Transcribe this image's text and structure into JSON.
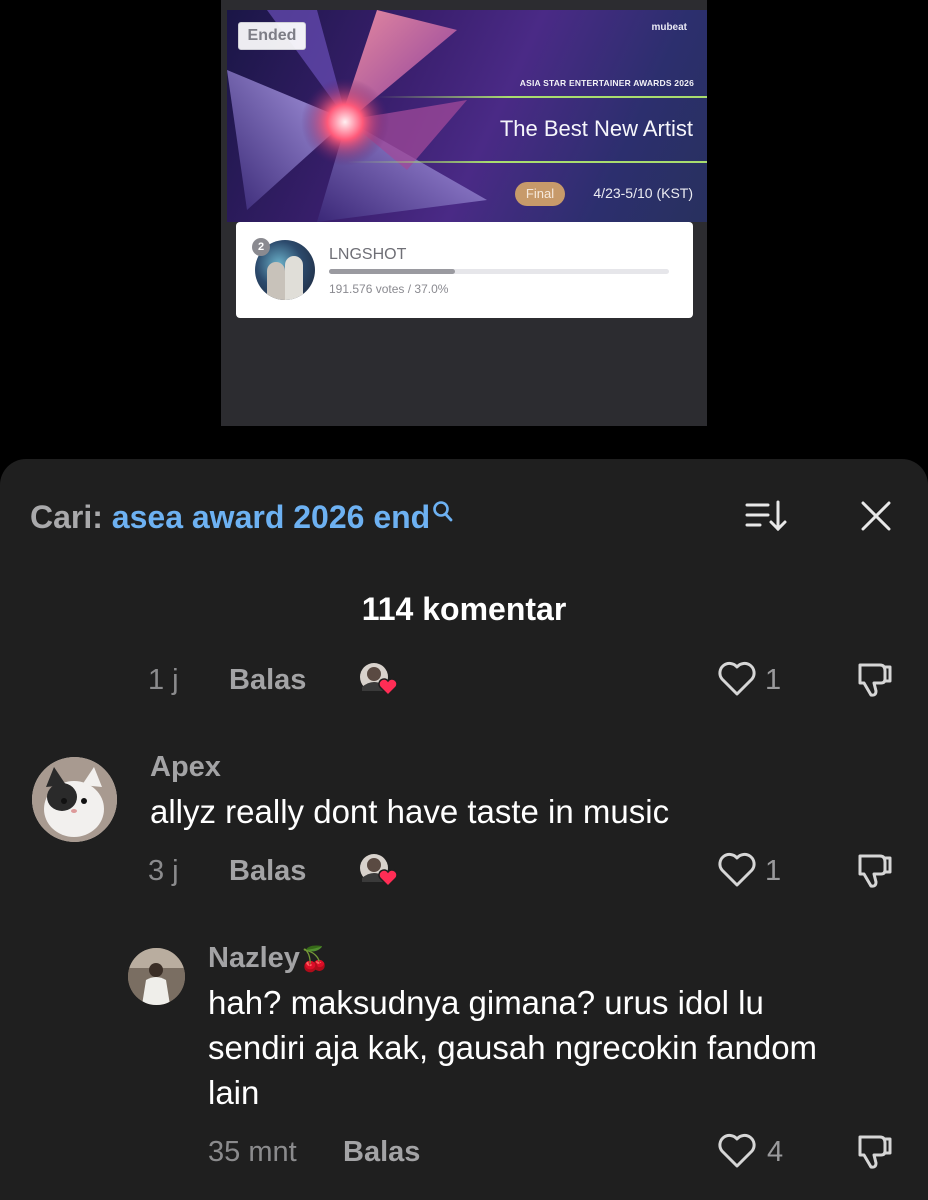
{
  "card": {
    "status_badge": "Ended",
    "brand": "mubeat",
    "award_name": "ASIA STAR ENTERTAINER AWARDS 2026",
    "category": "The Best New Artist",
    "round": "Final",
    "dates": "4/23-5/10 (KST)",
    "entry": {
      "rank": "2",
      "artist": "LNGSHOT",
      "votes_text": "191.576 votes / 37.0%",
      "progress_percent": 37.0
    }
  },
  "sheet": {
    "search_label": "Cari:",
    "search_query": "asea award 2026 end",
    "comment_count": "114 komentar",
    "icons": {
      "search": "search-icon",
      "sort": "sort-icon",
      "close": "close-icon"
    }
  },
  "comments": [
    {
      "time": "1 j",
      "reply_label": "Balas",
      "likes": "1"
    },
    {
      "username": "Apex",
      "text": "allyz really dont have taste in music",
      "time": "3 j",
      "reply_label": "Balas",
      "likes": "1"
    },
    {
      "username": "Nazley",
      "emoji": "🍒",
      "text_lines": [
        "hah? maksudnya gimana? urus idol lu",
        "sendiri aja kak, gausah ngrecokin fandom",
        "lain"
      ],
      "time": "35 mnt",
      "reply_label": "Balas",
      "likes": "4"
    }
  ]
}
